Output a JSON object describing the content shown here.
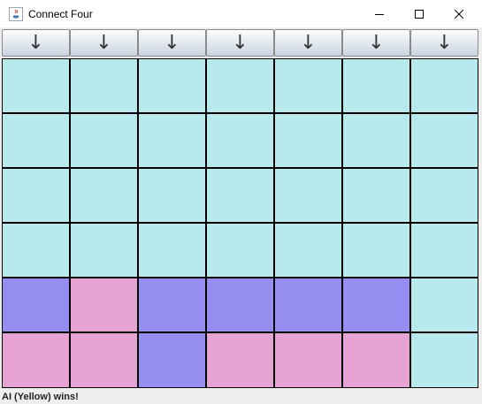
{
  "window": {
    "title": "Connect Four",
    "icon": "java-app-icon",
    "controls": [
      "minimize-icon",
      "maximize-icon",
      "close-icon"
    ]
  },
  "drop_buttons": {
    "labels": [
      "↓",
      "↓",
      "↓",
      "↓",
      "↓",
      "↓",
      "↓"
    ],
    "icon": "down-arrow-icon"
  },
  "board": {
    "rows": 6,
    "columns": 7,
    "colors": {
      "empty": "#b7e9ed",
      "player_purple": "#958def",
      "player_pink": "#e8a3d5"
    },
    "cells": [
      [
        "empty",
        "empty",
        "empty",
        "empty",
        "empty",
        "empty",
        "empty"
      ],
      [
        "empty",
        "empty",
        "empty",
        "empty",
        "empty",
        "empty",
        "empty"
      ],
      [
        "empty",
        "empty",
        "empty",
        "empty",
        "empty",
        "empty",
        "empty"
      ],
      [
        "empty",
        "empty",
        "empty",
        "empty",
        "empty",
        "empty",
        "empty"
      ],
      [
        "player_purple",
        "player_pink",
        "player_purple",
        "player_purple",
        "player_purple",
        "player_purple",
        "empty"
      ],
      [
        "player_pink",
        "player_pink",
        "player_purple",
        "player_pink",
        "player_pink",
        "player_pink",
        "empty"
      ]
    ]
  },
  "status": {
    "text": "AI (Yellow) wins!"
  }
}
